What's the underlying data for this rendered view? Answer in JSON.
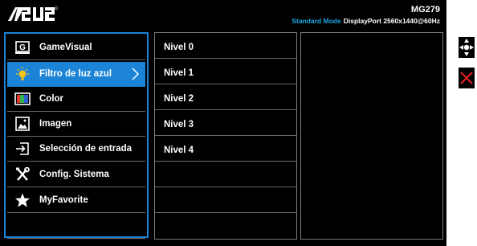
{
  "header": {
    "brand": "ASUS",
    "model": "MG279",
    "mode": "Standard Mode",
    "input_info": "DisplayPort  2560x1440@60Hz"
  },
  "main_menu": {
    "items": [
      {
        "label": "GameVisual",
        "icon": "gamevisual-icon"
      },
      {
        "label": "Filtro de luz azul",
        "icon": "blue-light-icon",
        "active": true
      },
      {
        "label": "Color",
        "icon": "color-icon"
      },
      {
        "label": "Imagen",
        "icon": "image-icon"
      },
      {
        "label": "Selección de entrada",
        "icon": "input-select-icon"
      },
      {
        "label": "Config. Sistema",
        "icon": "wrench-screwdriver-icon"
      },
      {
        "label": "MyFavorite",
        "icon": "star-icon"
      }
    ]
  },
  "sub_menu": {
    "items": [
      {
        "label": "Nivel 0"
      },
      {
        "label": "Nivel 1"
      },
      {
        "label": "Nivel 2"
      },
      {
        "label": "Nivel 3"
      },
      {
        "label": "Nivel 4"
      }
    ]
  },
  "side_buttons": [
    {
      "icon": "navigation-joystick-icon"
    },
    {
      "icon": "close-icon"
    }
  ],
  "colors": {
    "accent": "#1b84d6",
    "mode_text": "#1aa6e0",
    "close": "#e0201e"
  }
}
